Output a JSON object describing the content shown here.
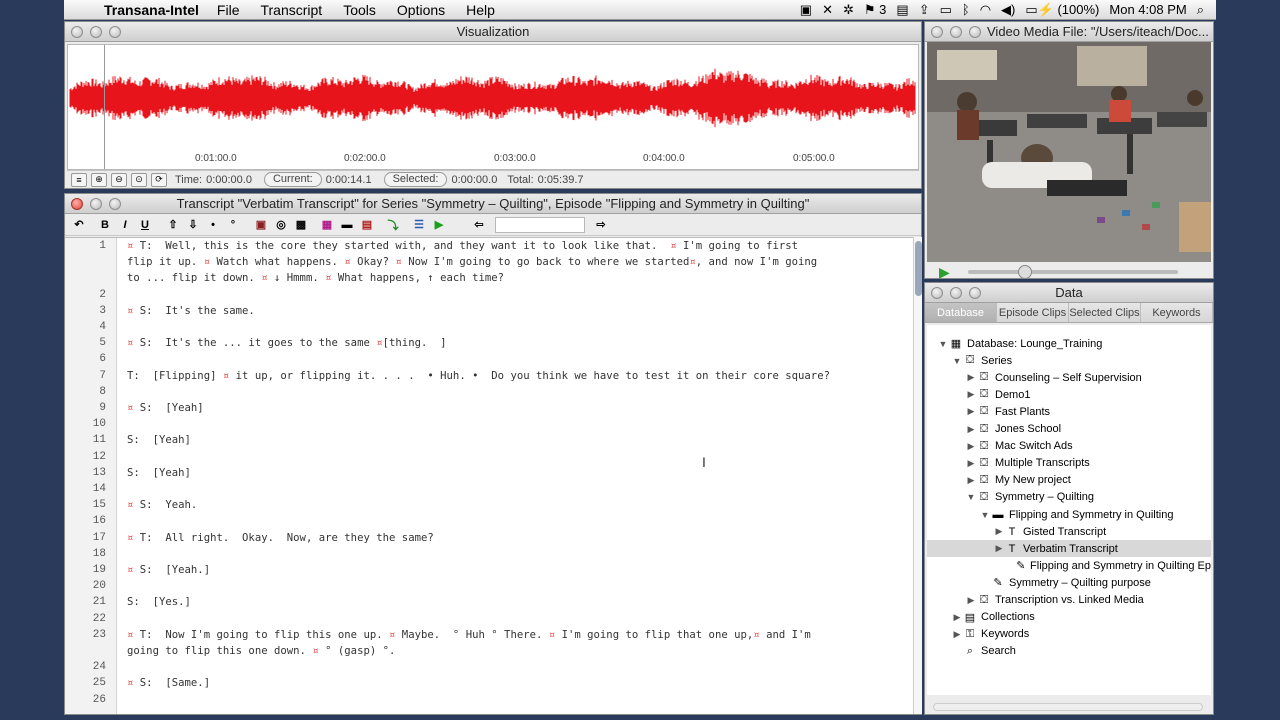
{
  "menubar": {
    "app": "Transana-Intel",
    "menus": [
      "File",
      "Transcript",
      "Tools",
      "Options",
      "Help"
    ],
    "badge_count": "3",
    "battery": "(100%)",
    "clock": "Mon 4:08 PM"
  },
  "visualization": {
    "title": "Visualization",
    "time_ticks": [
      "0:01:00.0",
      "0:02:00.0",
      "0:03:00.0",
      "0:04:00.0",
      "0:05:00.0"
    ],
    "time_label": "Time:",
    "time_value": "0:00:00.0",
    "current_label": "Current:",
    "current_value": "0:00:14.1",
    "selected_label": "Selected:",
    "selected_value": "0:00:00.0",
    "total_label": "Total:",
    "total_value": "0:05:39.7",
    "waveform_color": "#e8141c"
  },
  "video": {
    "title": "Video Media File: \"/Users/iteach/Doc..."
  },
  "transcript": {
    "title": "Transcript \"Verbatim Transcript\" for Series \"Symmetry – Quilting\", Episode \"Flipping and Symmetry in Quilting\"",
    "lines": [
      {
        "n": "1",
        "text": "¤ T:  Well, this is the core they started with, and they want it to look like that.  ¤ I'm going to first"
      },
      {
        "n": "",
        "text": "flip it up. ¤ Watch what happens. ¤ Okay? ¤ Now I'm going to go back to where we started¤, and now I'm going"
      },
      {
        "n": "",
        "text": "to ... flip it down. ¤ ↓ Hmmm. ¤ What happens, ↑ each time?"
      },
      {
        "n": "2",
        "text": ""
      },
      {
        "n": "3",
        "text": "¤ S:  It's the same."
      },
      {
        "n": "4",
        "text": ""
      },
      {
        "n": "5",
        "text": "¤ S:  It's the ... it goes to the same ¤[thing.  ]"
      },
      {
        "n": "6",
        "text": ""
      },
      {
        "n": "7",
        "text": "T:  [Flipping] ¤ it up, or flipping it. . . .  • Huh. •  Do you think we have to test it on their core square?"
      },
      {
        "n": "8",
        "text": ""
      },
      {
        "n": "9",
        "text": "¤ S:  [Yeah]"
      },
      {
        "n": "10",
        "text": ""
      },
      {
        "n": "11",
        "text": "S:  [Yeah]"
      },
      {
        "n": "12",
        "text": ""
      },
      {
        "n": "13",
        "text": "S:  [Yeah]"
      },
      {
        "n": "14",
        "text": ""
      },
      {
        "n": "15",
        "text": "¤ S:  Yeah."
      },
      {
        "n": "16",
        "text": ""
      },
      {
        "n": "17",
        "text": "¤ T:  All right.  Okay.  Now, are they the same?"
      },
      {
        "n": "18",
        "text": ""
      },
      {
        "n": "19",
        "text": "¤ S:  [Yeah.]"
      },
      {
        "n": "20",
        "text": ""
      },
      {
        "n": "21",
        "text": "S:  [Yes.]"
      },
      {
        "n": "22",
        "text": ""
      },
      {
        "n": "23",
        "text": "¤ T:  Now I'm going to flip this one up. ¤ Maybe.  ° Huh ° There. ¤ I'm going to flip that one up,¤ and I'm"
      },
      {
        "n": "",
        "text": "going to flip this one down. ¤ ° (gasp) °."
      },
      {
        "n": "24",
        "text": ""
      },
      {
        "n": "25",
        "text": "¤ S:  [Same.]"
      },
      {
        "n": "26",
        "text": ""
      }
    ]
  },
  "data_panel": {
    "title": "Data",
    "tabs": [
      "Database",
      "Episode Clips",
      "Selected Clips",
      "Keywords"
    ],
    "tree": [
      {
        "label": "Database: Lounge_Training",
        "icon": "database-icon"
      },
      {
        "label": "Series",
        "icon": "series-icon"
      },
      {
        "label": "Counseling – Self Supervision",
        "icon": "series-item-icon"
      },
      {
        "label": "Demo1",
        "icon": "series-item-icon"
      },
      {
        "label": "Fast Plants",
        "icon": "series-item-icon"
      },
      {
        "label": "Jones School",
        "icon": "series-item-icon"
      },
      {
        "label": "Mac Switch Ads",
        "icon": "series-item-icon"
      },
      {
        "label": "Multiple Transcripts",
        "icon": "series-item-icon"
      },
      {
        "label": "My New project",
        "icon": "series-item-icon"
      },
      {
        "label": "Symmetry – Quilting",
        "icon": "series-item-icon"
      },
      {
        "label": "Flipping and Symmetry in Quilting",
        "icon": "episode-icon"
      },
      {
        "label": "Gisted Transcript",
        "icon": "transcript-icon"
      },
      {
        "label": "Verbatim Transcript",
        "icon": "transcript-icon"
      },
      {
        "label": "Flipping and Symmetry in Quilting Ep",
        "icon": "note-icon"
      },
      {
        "label": "Symmetry – Quilting purpose",
        "icon": "note-icon"
      },
      {
        "label": "Transcription vs. Linked Media",
        "icon": "series-item-icon"
      },
      {
        "label": "Collections",
        "icon": "collections-icon"
      },
      {
        "label": "Keywords",
        "icon": "keywords-icon"
      },
      {
        "label": "Search",
        "icon": "search-icon"
      }
    ]
  }
}
